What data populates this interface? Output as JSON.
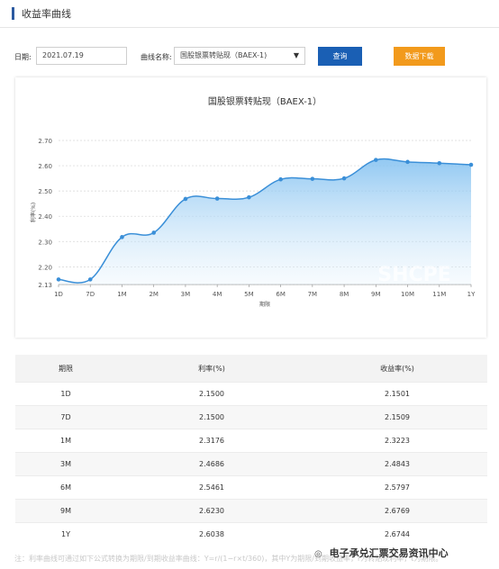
{
  "header": {
    "title": "收益率曲线"
  },
  "filters": {
    "date_label": "日期:",
    "date_value": "2021.07.19",
    "curve_label": "曲线名称:",
    "curve_value": "国股银票转贴现（BAEX-1)",
    "query_label": "查询",
    "download_label": "数据下载"
  },
  "colors": {
    "accent_blue": "#1a5fb4",
    "download_orange": "#f29a1c",
    "line_blue": "#3a8fd8"
  },
  "chart_data": {
    "type": "area",
    "title": "国股银票转贴现（BAEX-1）",
    "xlabel": "期限",
    "ylabel": "利率(%)",
    "categories": [
      "1D",
      "7D",
      "1M",
      "2M",
      "3M",
      "4M",
      "5M",
      "6M",
      "7M",
      "8M",
      "9M",
      "10M",
      "11M",
      "1Y"
    ],
    "values": [
      2.15,
      2.15,
      2.3176,
      2.335,
      2.4686,
      2.47,
      2.475,
      2.5461,
      2.548,
      2.55,
      2.623,
      2.615,
      2.61,
      2.6038
    ],
    "y_ticks": [
      "2.13",
      "2.20",
      "2.30",
      "2.40",
      "2.50",
      "2.60",
      "2.70"
    ],
    "ylim": [
      2.13,
      2.7
    ],
    "grid": true,
    "watermark": "SHCPE"
  },
  "table": {
    "headers": [
      "期限",
      "利率(%)",
      "收益率(%)"
    ],
    "rows": [
      [
        "1D",
        "2.1500",
        "2.1501"
      ],
      [
        "7D",
        "2.1500",
        "2.1509"
      ],
      [
        "1M",
        "2.3176",
        "2.3223"
      ],
      [
        "3M",
        "2.4686",
        "2.4843"
      ],
      [
        "6M",
        "2.5461",
        "2.5797"
      ],
      [
        "9M",
        "2.6230",
        "2.6769"
      ],
      [
        "1Y",
        "2.6038",
        "2.6744"
      ]
    ]
  },
  "footer": {
    "note": "注：利率曲线可通过如下公式转换为期限/到期收益率曲线：Y=r/(1−r×t/360)，其中Y为期限/到期收益率，r为转贴现利率，t为期限。",
    "badge": "电子承兑汇票交易资讯中心",
    "badge_icon": "wechat-icon"
  }
}
